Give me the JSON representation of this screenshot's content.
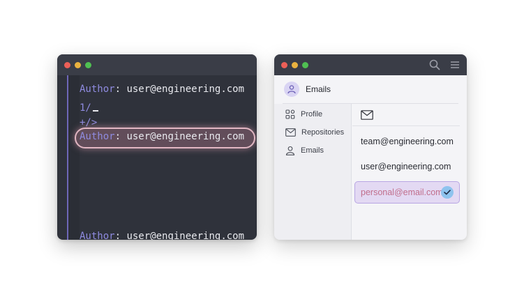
{
  "terminal": {
    "lines": [
      {
        "keyword": "Author",
        "sep": ":",
        "value": "user@engineering.com"
      },
      {
        "text": "1/"
      },
      {
        "text": "+/>"
      },
      {
        "keyword": "Author",
        "sep": ":",
        "value": "user@engineering.com"
      },
      {
        "keyword": "Author",
        "sep": ":",
        "value": "user@engineering.com"
      }
    ]
  },
  "mail": {
    "title": "Emails",
    "sidebar": [
      {
        "label": "Profile",
        "icon": "profile-grid-icon"
      },
      {
        "label": "Repositories",
        "icon": "envelope-icon"
      },
      {
        "label": "Emails",
        "icon": "person-icon"
      }
    ],
    "emails": [
      "team@engineering.com",
      "user@engineering.com",
      "personal@email.com"
    ],
    "selected_email": "personal@email.com"
  },
  "colors": {
    "terminal_bg": "#2f323b",
    "keyword": "#8f8be0",
    "highlight": "#e2b7c3",
    "selected_bg": "#e3d9f3",
    "selected_text": "#c16e8c",
    "check": "#8ec3ee"
  }
}
